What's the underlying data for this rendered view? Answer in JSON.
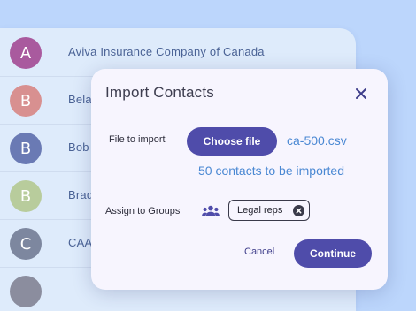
{
  "contacts": [
    {
      "initial": "A",
      "name": "Aviva Insurance Company of Canada",
      "color": "#a95a9e"
    },
    {
      "initial": "B",
      "name": "Bela",
      "color": "#d89090"
    },
    {
      "initial": "B",
      "name": "Bob",
      "color": "#6a7ab4"
    },
    {
      "initial": "B",
      "name": "Brad",
      "color": "#b8cc9c"
    },
    {
      "initial": "C",
      "name": "CAA",
      "color": "#7d879f"
    },
    {
      "initial": "",
      "name": "",
      "color": "#8b8d9e"
    }
  ],
  "dialog": {
    "title": "Import Contacts",
    "close_icon": "close-icon",
    "file_label": "File to import",
    "choose_file_label": "Choose file",
    "file_name": "ca-500.csv",
    "contacts_count_text": "50 contacts to be imported",
    "groups_label": "Assign to Groups",
    "groups_icon": "group-icon",
    "chips": [
      {
        "label": "Legal reps"
      }
    ],
    "cancel_label": "Cancel",
    "continue_label": "Continue"
  },
  "colors": {
    "page_background": "#bcd6fc",
    "list_background": "#deebfb",
    "dialog_background": "#f7f5fe",
    "primary_button": "#4f4caa",
    "link_text": "#4a88d3"
  }
}
